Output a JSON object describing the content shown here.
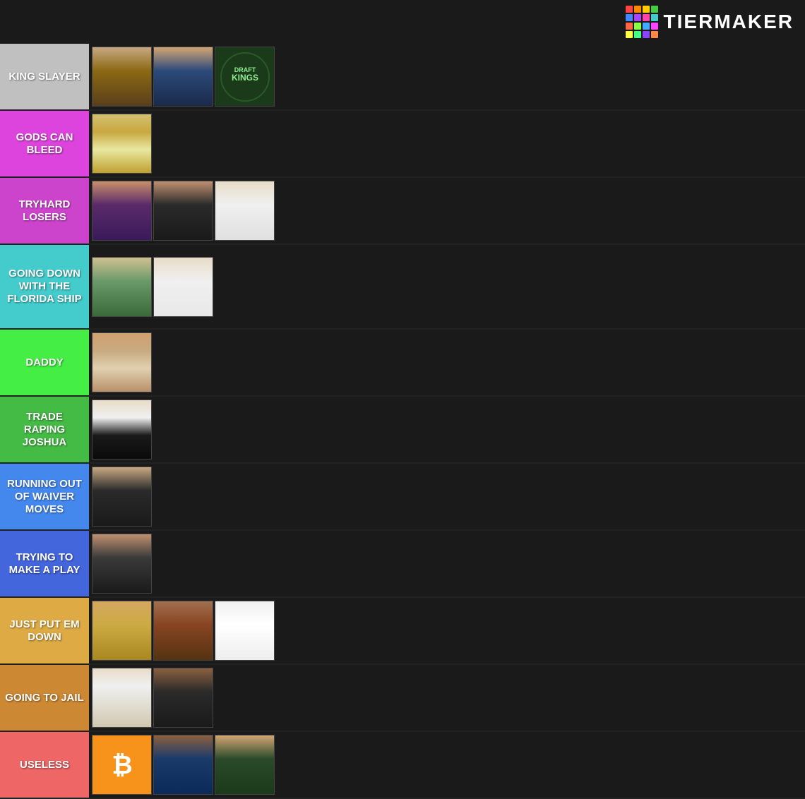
{
  "header": {
    "logo_text": "TiERMAKER",
    "logo_colors": [
      "#ff4444",
      "#ff8800",
      "#ffcc00",
      "#44cc44",
      "#4488ff",
      "#aa44ff",
      "#ff44aa",
      "#44cccc",
      "#ff6644",
      "#88ff44",
      "#44aaff",
      "#ff44ff",
      "#ffff44",
      "#44ff88",
      "#8844ff",
      "#ff8844"
    ]
  },
  "tiers": [
    {
      "id": "king-slayer",
      "label": "KING SLAYER",
      "color": "#c0c0c0",
      "text_color": "white",
      "images": [
        "p1",
        "p2",
        "draftkings"
      ]
    },
    {
      "id": "gods-can-bleed",
      "label": "GODS CAN BLEED",
      "color": "#dd44dd",
      "text_color": "white",
      "images": [
        "p4"
      ]
    },
    {
      "id": "tryhard-losers",
      "label": "TRYHARD LOSERS",
      "color": "#cc44cc",
      "text_color": "white",
      "images": [
        "p5",
        "p6",
        "p7"
      ]
    },
    {
      "id": "going-down",
      "label": "GOING DOWN WITH THE FLORIDA SHIP",
      "color": "#44cccc",
      "text_color": "white",
      "images": [
        "p8",
        "p9"
      ]
    },
    {
      "id": "daddy",
      "label": "DADDY",
      "color": "#44ee44",
      "text_color": "white",
      "images": [
        "p10"
      ]
    },
    {
      "id": "trade-raping",
      "label": "TRADE RAPING JOSHUA",
      "color": "#44bb44",
      "text_color": "white",
      "images": [
        "p11"
      ]
    },
    {
      "id": "running-out",
      "label": "RUNNING OUT OF WAIVER MOVES",
      "color": "#4488ee",
      "text_color": "white",
      "images": [
        "p13"
      ]
    },
    {
      "id": "trying-to-make",
      "label": "TRYING TO MAKE A PLAY",
      "color": "#4466dd",
      "text_color": "white",
      "images": [
        "p15"
      ]
    },
    {
      "id": "just-put",
      "label": "JUST PUT EM DOWN",
      "color": "#ddaa44",
      "text_color": "white",
      "images": [
        "p16",
        "p17",
        "p18"
      ]
    },
    {
      "id": "going-to-jail",
      "label": "GOING TO JAIL",
      "color": "#cc8833",
      "text_color": "white",
      "images": [
        "p19",
        "p20"
      ]
    },
    {
      "id": "useless",
      "label": "USELESS",
      "color": "#ee6666",
      "text_color": "white",
      "images": [
        "bitcoin",
        "p-kamala",
        "p-crown"
      ]
    }
  ]
}
